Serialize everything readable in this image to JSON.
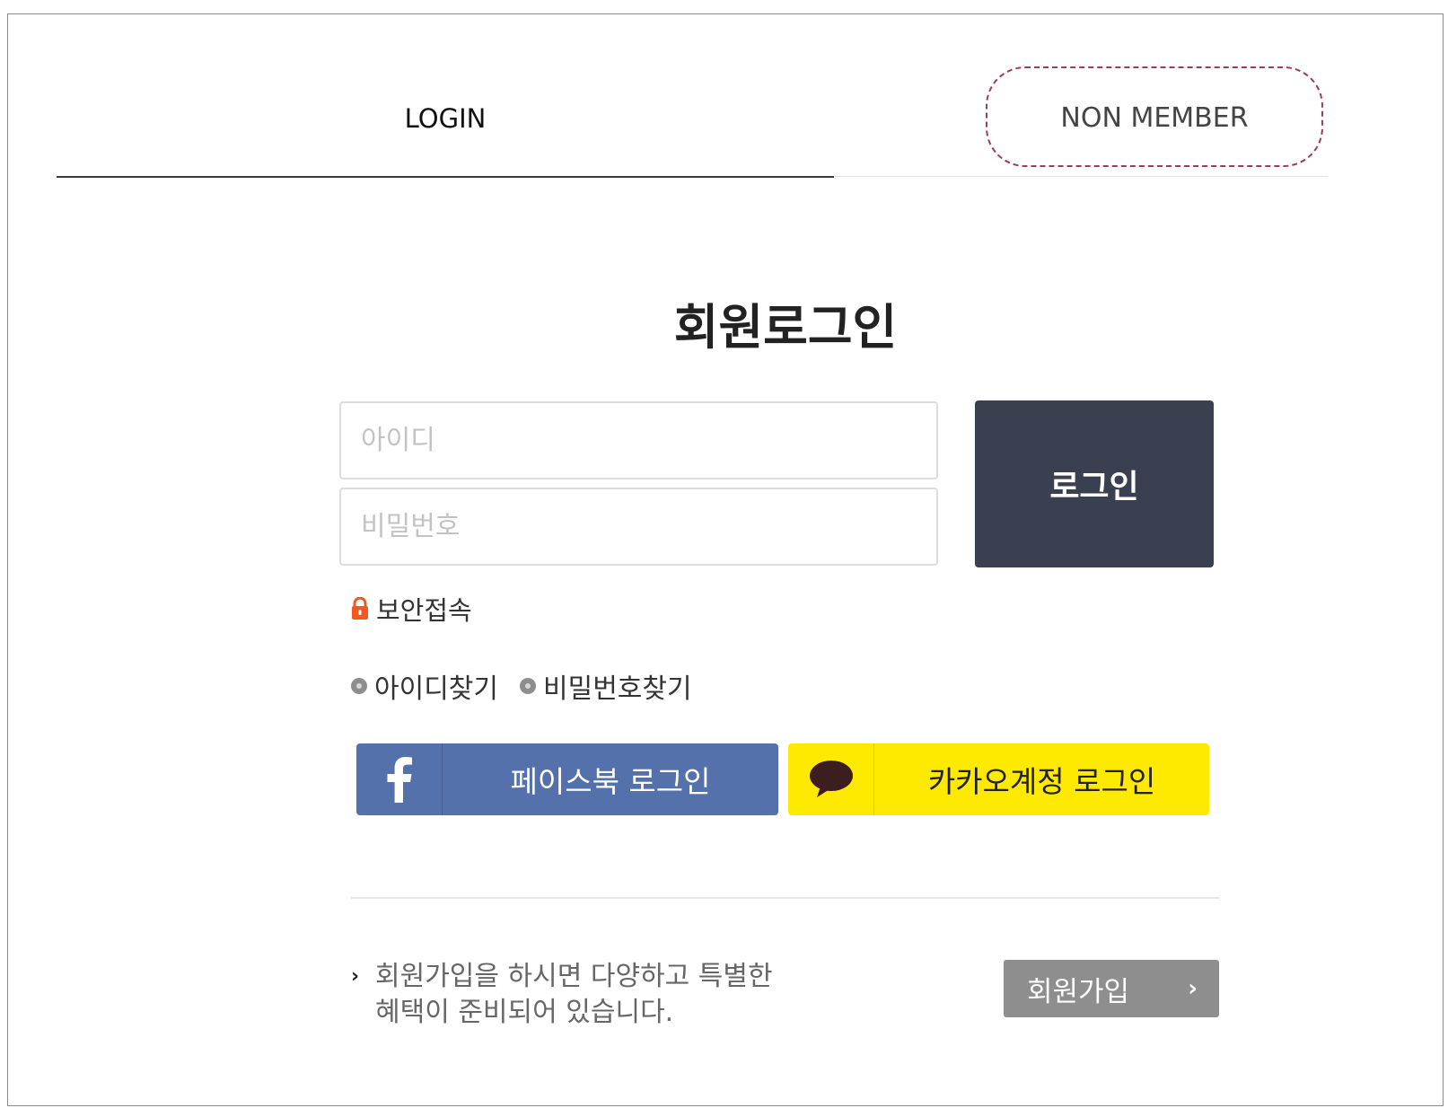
{
  "tabs": {
    "login_label": "LOGIN",
    "non_member_label": "NON MEMBER"
  },
  "login_form": {
    "title": "회원로그인",
    "id_placeholder": "아이디",
    "password_placeholder": "비밀번호",
    "login_button": "로그인",
    "secure_label": "보안접속"
  },
  "links": {
    "find_id": "아이디찾기",
    "find_password": "비밀번호찾기"
  },
  "social": {
    "facebook_label": "페이스북 로그인",
    "kakao_label": "카카오계정 로그인"
  },
  "join": {
    "note_line1": "회원가입을 하시면 다양하고 특별한",
    "note_line2": "혜택이 준비되어 있습니다.",
    "button_label": "회원가입"
  },
  "colors": {
    "login_button_bg": "#3b4051",
    "facebook_bg": "#5571ab",
    "kakao_bg": "#fee900",
    "lock_icon": "#f05a22",
    "join_button_bg": "#8e8e8e"
  },
  "icons": {
    "secure": "lock-icon",
    "facebook": "facebook-f-icon",
    "kakao": "speech-bubble-icon",
    "join_arrow": "chevron-right-icon"
  }
}
